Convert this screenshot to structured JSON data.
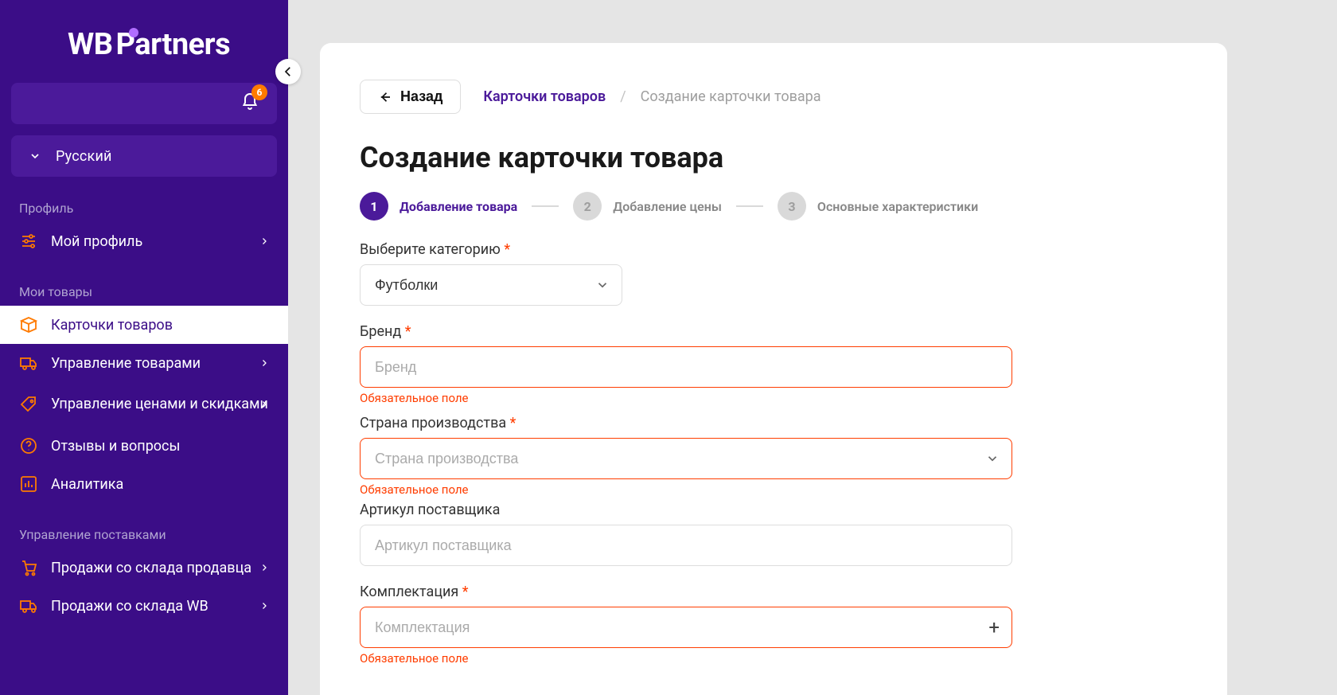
{
  "brand": {
    "logo_1": "WB",
    "logo_2": "Partners"
  },
  "notif": {
    "count": "6"
  },
  "lang": {
    "label": "Русский"
  },
  "sections": {
    "profile": "Профиль",
    "goods": "Мои товары",
    "supply": "Управление поставками"
  },
  "nav": {
    "my_profile": "Мой профиль",
    "cards": "Карточки товаров",
    "manage_goods": "Управление товарами",
    "manage_prices": "Управление ценами и скидками",
    "reviews": "Отзывы и вопросы",
    "analytics": "Аналитика",
    "sales_seller": "Продажи со склада продавца",
    "sales_wb": "Продажи со склада WB"
  },
  "header": {
    "back": "Назад",
    "bc_link": "Карточки товаров",
    "bc_sep": "/",
    "bc_current": "Создание карточки товара",
    "title": "Создание карточки товара"
  },
  "steps": {
    "s1_num": "1",
    "s1_label": "Добавление товара",
    "s2_num": "2",
    "s2_label": "Добавление цены",
    "s3_num": "3",
    "s3_label": "Основные характеристики"
  },
  "form": {
    "category_label": "Выберите категорию",
    "category_value": "Футболки",
    "brand_label": "Бренд",
    "brand_placeholder": "Бренд",
    "required_msg": "Обязательное поле",
    "country_label": "Страна производства",
    "country_placeholder": "Страна производства",
    "sku_label": "Артикул поставщика",
    "sku_placeholder": "Артикул поставщика",
    "kit_label": "Комплектация",
    "kit_placeholder": "Комплектация"
  }
}
